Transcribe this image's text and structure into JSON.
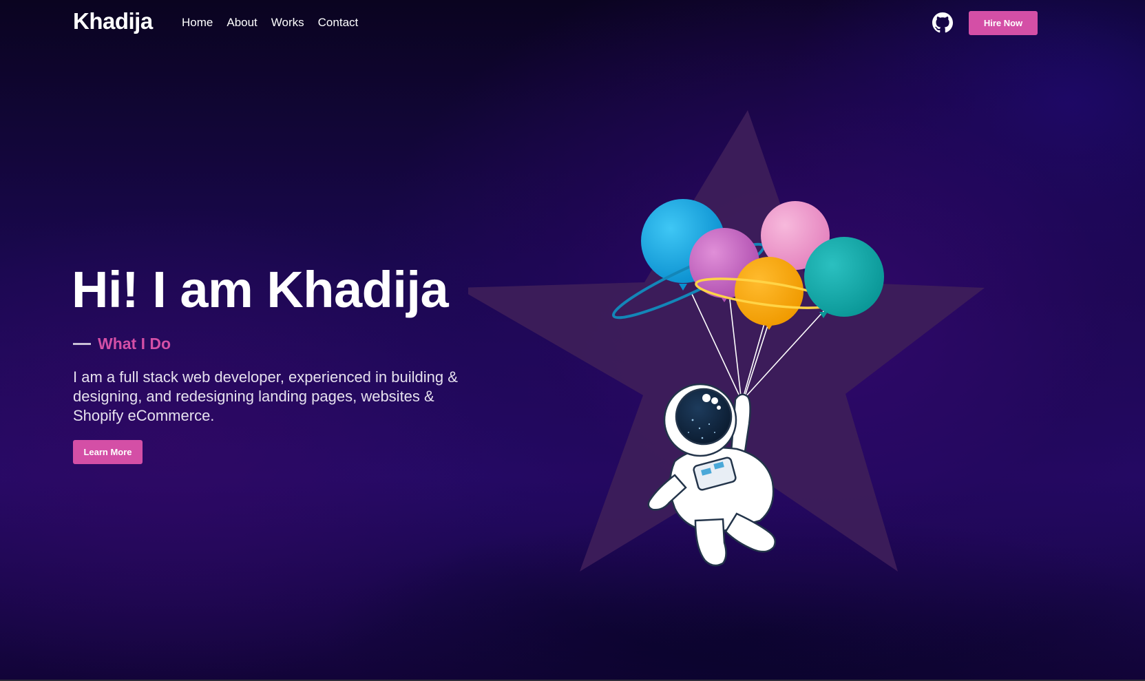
{
  "header": {
    "logo": "Khadija",
    "nav": [
      {
        "label": "Home"
      },
      {
        "label": "About"
      },
      {
        "label": "Works"
      },
      {
        "label": "Contact"
      }
    ],
    "github_icon": "github-icon",
    "hire_label": "Hire Now"
  },
  "hero": {
    "title": "Hi! I am Khadija",
    "subtitle": "What I Do",
    "description": "I am a full stack web developer, experienced in building & designing, and redesigning landing pages, websites & Shopify eCommerce.",
    "cta_label": "Learn More",
    "illustration": "astronaut-with-balloons-on-star"
  },
  "colors": {
    "accent": "#d44fa6",
    "background": "#1a0850",
    "star": "#3d1d5a"
  }
}
